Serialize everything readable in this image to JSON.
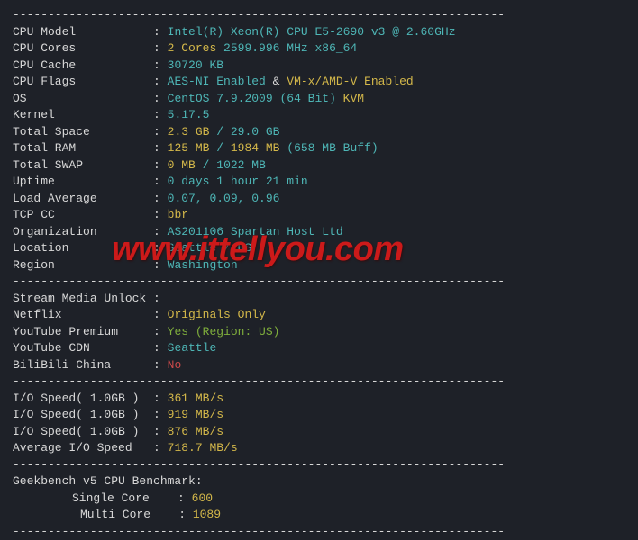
{
  "dashes": "----------------------------------------------------------------------",
  "sys": {
    "rows": [
      {
        "label": "CPU Model",
        "segs": [
          {
            "t": "Intel(R) Xeon(R) CPU E5-2690 v3 @ 2.60GHz",
            "c": "cyan"
          }
        ]
      },
      {
        "label": "CPU Cores",
        "segs": [
          {
            "t": "2 Cores",
            "c": "yellow"
          },
          {
            "t": " 2599.996 MHz x86_64",
            "c": "cyan"
          }
        ]
      },
      {
        "label": "CPU Cache",
        "segs": [
          {
            "t": "30720 KB",
            "c": "cyan"
          }
        ]
      },
      {
        "label": "CPU Flags",
        "segs": [
          {
            "t": "AES-NI Enabled",
            "c": "cyan"
          },
          {
            "t": " & ",
            "c": "white"
          },
          {
            "t": "VM-x/AMD-V Enabled",
            "c": "yellow"
          }
        ]
      },
      {
        "label": "OS",
        "segs": [
          {
            "t": "CentOS 7.9.2009 (64 Bit)",
            "c": "cyan"
          },
          {
            "t": " KVM",
            "c": "yellow"
          }
        ]
      },
      {
        "label": "Kernel",
        "segs": [
          {
            "t": "5.17.5",
            "c": "cyan"
          }
        ]
      },
      {
        "label": "Total Space",
        "segs": [
          {
            "t": "2.3 GB",
            "c": "yellow"
          },
          {
            "t": " / ",
            "c": "cyan"
          },
          {
            "t": "29.0 GB",
            "c": "cyan"
          }
        ]
      },
      {
        "label": "Total RAM",
        "segs": [
          {
            "t": "125 MB",
            "c": "yellow"
          },
          {
            "t": " / ",
            "c": "cyan"
          },
          {
            "t": "1984 MB",
            "c": "yellow"
          },
          {
            "t": " (658 MB Buff)",
            "c": "cyan"
          }
        ]
      },
      {
        "label": "Total SWAP",
        "segs": [
          {
            "t": "0 MB",
            "c": "yellow"
          },
          {
            "t": " / 1022 MB",
            "c": "cyan"
          }
        ]
      },
      {
        "label": "Uptime",
        "segs": [
          {
            "t": "0 days 1 hour 21 min",
            "c": "cyan"
          }
        ]
      },
      {
        "label": "Load Average",
        "segs": [
          {
            "t": "0.07, 0.09, 0.96",
            "c": "cyan"
          }
        ]
      },
      {
        "label": "TCP CC",
        "segs": [
          {
            "t": "bbr",
            "c": "yellow"
          }
        ]
      },
      {
        "label": "Organization",
        "segs": [
          {
            "t": "AS201106 Spartan Host Ltd",
            "c": "cyan"
          }
        ]
      },
      {
        "label": "Location",
        "segs": [
          {
            "t": "Seattle / US",
            "c": "cyan"
          }
        ]
      },
      {
        "label": "Region",
        "segs": [
          {
            "t": "Washington",
            "c": "cyan"
          }
        ]
      }
    ]
  },
  "stream": {
    "header": {
      "label": "Stream Media Unlock",
      "segs": []
    },
    "rows": [
      {
        "label": "Netflix",
        "segs": [
          {
            "t": "Originals Only",
            "c": "yellow"
          }
        ]
      },
      {
        "label": "YouTube Premium",
        "segs": [
          {
            "t": "Yes (Region: US)",
            "c": "green"
          }
        ]
      },
      {
        "label": "YouTube CDN",
        "segs": [
          {
            "t": "Seattle",
            "c": "cyan"
          }
        ]
      },
      {
        "label": "BiliBili China",
        "segs": [
          {
            "t": "No",
            "c": "red"
          }
        ]
      }
    ]
  },
  "io": {
    "rows": [
      {
        "label": "I/O Speed( 1.0GB )",
        "segs": [
          {
            "t": "361 MB/s",
            "c": "yellow"
          }
        ]
      },
      {
        "label": "I/O Speed( 1.0GB )",
        "segs": [
          {
            "t": "919 MB/s",
            "c": "yellow"
          }
        ]
      },
      {
        "label": "I/O Speed( 1.0GB )",
        "segs": [
          {
            "t": "876 MB/s",
            "c": "yellow"
          }
        ]
      },
      {
        "label": "Average I/O Speed",
        "segs": [
          {
            "t": "718.7 MB/s",
            "c": "yellow"
          }
        ]
      }
    ]
  },
  "geek": {
    "header": "Geekbench v5 CPU Benchmark:",
    "single_label": "Single Core",
    "single_val": "600",
    "multi_label": "Multi Core",
    "multi_val": "1089"
  },
  "watermark": "www.ittellyou.com"
}
